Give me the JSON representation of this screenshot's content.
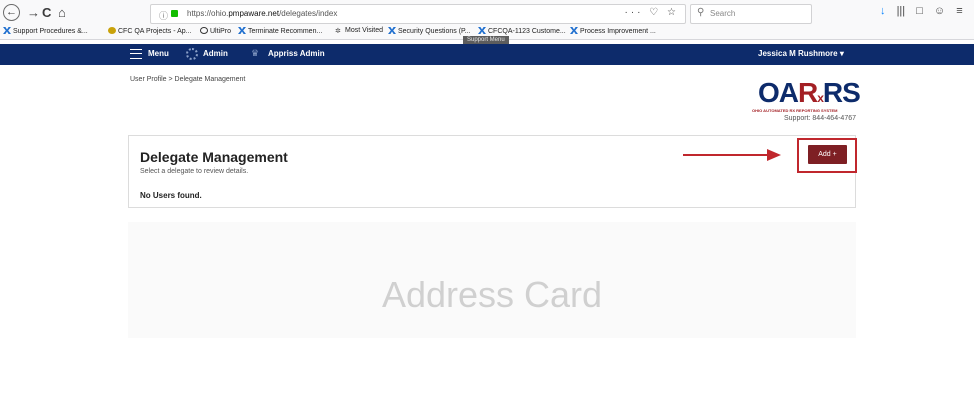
{
  "browser": {
    "back_glyph": "←",
    "forward_glyph": "→",
    "reload_glyph": "C",
    "home_glyph": "⌂",
    "info_glyph": "ⓘ",
    "url_prefix": "https://ohio.",
    "url_host": "pmpaware.net",
    "url_path": "/delegates/index",
    "url_actions": "··· ♡ ☆",
    "search_placeholder": "Search",
    "toolbar_icons": [
      "↓",
      "|||",
      "□",
      "☺",
      "≡"
    ]
  },
  "bookmarks": [
    {
      "label": "Support Procedures &...",
      "icon": "x"
    },
    {
      "label": "CFC QA Projects - Ap...",
      "icon": "g"
    },
    {
      "label": "UltiPro",
      "icon": "u"
    },
    {
      "label": "Terminate Recommen...",
      "icon": "x"
    },
    {
      "label": "Most Visited",
      "icon": "s"
    },
    {
      "label": "Security Questions (P...",
      "icon": "x"
    },
    {
      "label": "CFCQA-1123 Custome...",
      "icon": "x"
    },
    {
      "label": "Process Improvement ...",
      "icon": "x"
    }
  ],
  "tooltip": "Support Menu",
  "nav": {
    "menu_label": "Menu",
    "admin_label": "Admin",
    "appriss_label": "Appriss Admin",
    "user_name": "Jessica M Rushmore ▾"
  },
  "breadcrumb": "User Profile > Delegate Management",
  "logo": {
    "text_oa": "OA",
    "text_r": "R",
    "text_x": "x",
    "text_rs": "RS",
    "subtitle": "OHIO AUTOMATED RX REPORTING SYSTEM",
    "support": "Support: 844-464-4767"
  },
  "panel": {
    "title": "Delegate Management",
    "subtitle": "Select a delegate to review details.",
    "empty_text": "No Users found.",
    "add_label": "Add +"
  },
  "address_card": {
    "title": "Address Card"
  },
  "colors": {
    "nav_bg": "#0d2b6b",
    "add_button": "#7e1f24",
    "highlight": "#c0272d"
  }
}
